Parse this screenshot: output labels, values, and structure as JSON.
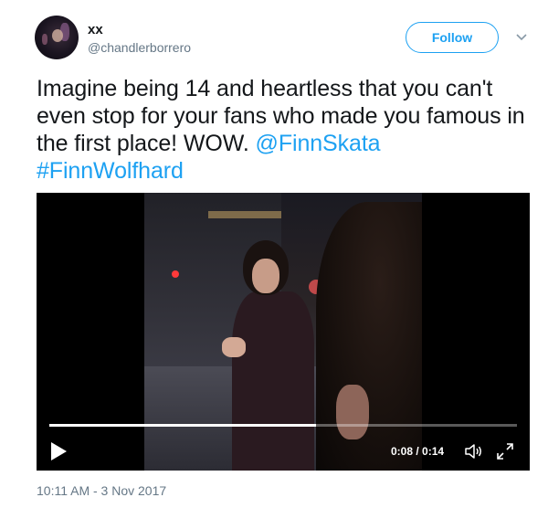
{
  "author": {
    "display_name": "xx",
    "screen_name": "@chandlerborrero"
  },
  "follow_button": {
    "label": "Follow"
  },
  "tweet": {
    "text_plain": "Imagine being 14 and heartless that you can't even stop for your fans who made you famous in the first place! WOW.",
    "mention": "@FinnSkata",
    "hashtag": "#FinnWolfhard",
    "timestamp": "10:11 AM - 3 Nov 2017"
  },
  "video": {
    "time_display": "0:08 / 0:14",
    "progress": 0.57
  },
  "icons": {
    "caret": "chevron-down-icon",
    "play": "play-icon",
    "volume": "volume-icon",
    "fullscreen": "fullscreen-icon"
  },
  "colors": {
    "link": "#1da1f2",
    "secondary_text": "#657786",
    "primary_text": "#14171a"
  }
}
